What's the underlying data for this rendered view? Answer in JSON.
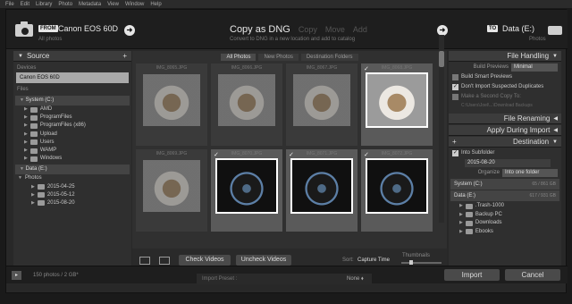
{
  "menubar": [
    "File",
    "Edit",
    "Library",
    "Photo",
    "Metadata",
    "View",
    "Window",
    "Help"
  ],
  "topbar": {
    "from_badge": "FROM",
    "source_device": "Canon EOS 60D",
    "source_sub": "All photos",
    "modes": [
      {
        "label": "Copy as DNG",
        "active": true
      },
      {
        "label": "Copy",
        "active": false
      },
      {
        "label": "Move",
        "active": false
      },
      {
        "label": "Add",
        "active": false
      }
    ],
    "mode_desc": "Convert to DNG in a new location and add to catalog",
    "to_badge": "TO",
    "dest_device": "Data (E:)",
    "dest_sub": "Photos"
  },
  "source_panel": {
    "title": "Source",
    "add": "+",
    "devices_label": "Devices",
    "device": "Canon EOS 60D",
    "files_label": "Files",
    "system_drive": "System (C:)",
    "system_folders": [
      "AMD",
      "ProgramFiles",
      "ProgramFiles (x86)",
      "Upload",
      "Users",
      "WAMP",
      "Windows"
    ],
    "data_drive": "Data (E:)",
    "photos_folder": "Photos",
    "photo_subfolders": [
      "2015-04-25",
      "2015-05-12",
      "2015-08-20"
    ]
  },
  "center": {
    "tabs": [
      "All Photos",
      "New Photos",
      "Destination Folders"
    ],
    "selected_tab": "All Photos",
    "thumbnails": [
      {
        "name": "IMG_8065.JPG",
        "checked": false,
        "kind": "cookie"
      },
      {
        "name": "IMG_8066.JPG",
        "checked": false,
        "kind": "cookie"
      },
      {
        "name": "IMG_8067.JPG",
        "checked": false,
        "kind": "cookie"
      },
      {
        "name": "IMG_8068.JPG",
        "checked": true,
        "kind": "cookie"
      },
      {
        "name": "IMG_8069.JPG",
        "checked": false,
        "kind": "cookie"
      },
      {
        "name": "IMG_8070.JPG",
        "checked": true,
        "kind": "lens"
      },
      {
        "name": "IMG_8071.JPG",
        "checked": true,
        "kind": "lens"
      },
      {
        "name": "IMG_8072.JPG",
        "checked": true,
        "kind": "lens"
      }
    ],
    "check_videos": "Check Videos",
    "uncheck_videos": "Uncheck Videos",
    "sort_label": "Sort:",
    "sort_value": "Capture Time",
    "thumbnails_label": "Thumbnails"
  },
  "right_panel": {
    "file_handling": "File Handling",
    "build_previews_label": "Build Previews",
    "build_previews_value": "Minimal",
    "build_smart": "Build Smart Previews",
    "dont_import_dupes": "Don't Import Suspected Duplicates",
    "second_copy": "Make a Second Copy To:",
    "second_copy_path": "C:\\Users\\Joel\\...\\Download Backups",
    "file_renaming": "File Renaming",
    "apply_during_import": "Apply During Import",
    "destination": "Destination",
    "into_subfolder": "Into Subfolder",
    "subfolder_name": "2015-08-20",
    "organize_label": "Organize",
    "organize_value": "Into one folder",
    "dest_drives": [
      {
        "name": "System (C:)",
        "size": "65 / 861 GB"
      },
      {
        "name": "Data (E:)",
        "size": "617 / 931 GB"
      }
    ],
    "dest_folders": [
      ".Trash-1000",
      "Backup PC",
      "Downloads",
      "Ebooks"
    ]
  },
  "bottombar": {
    "expand": "▸",
    "count": "150 photos / 2 GB*",
    "import": "Import",
    "cancel": "Cancel",
    "preset_label": "Import Preset :",
    "preset_value": "None ⬧"
  }
}
